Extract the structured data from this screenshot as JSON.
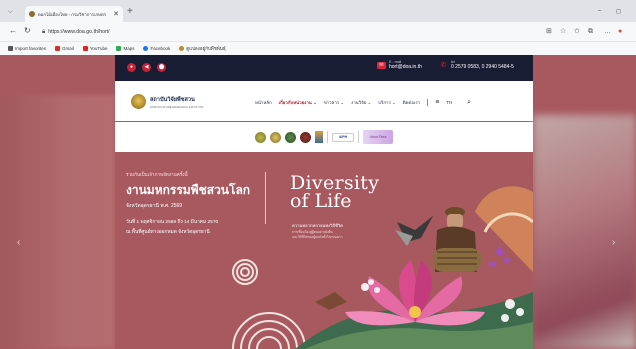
{
  "browser": {
    "tab_title": "ดอกไม้เมืองไทย - กรมวิชาการเกษตร",
    "url": "https://www.doa.go.th/hort/",
    "favorites": [
      {
        "label": "Import favorites",
        "color": "#555555"
      },
      {
        "label": "Gmail",
        "color": "#555555"
      },
      {
        "label": "YouTube",
        "color": "#e02424"
      },
      {
        "label": "Maps",
        "color": "#555555"
      },
      {
        "label": "Facebook",
        "color": "#1877f2"
      },
      {
        "label": "ดูแปลงอยู่กับพืชพันธุ์",
        "color": "#b58f2e"
      }
    ]
  },
  "site": {
    "contact": {
      "email_label": "E - mail",
      "email": "hort@doa.in.th",
      "tel_label": "tel",
      "tel": "0 2579 0583, 0 2940 5484-5"
    },
    "logo": {
      "name": "สถาบันวิจัยพืชสวน",
      "subtitle": "HORTICULTURE RESEARCH INSTITUTE"
    },
    "menu": [
      {
        "label": "หน้าหลัก",
        "active": false
      },
      {
        "label": "เกี่ยวกับหน่วยงาน ⌄",
        "active": true
      },
      {
        "label": "ข่าวสาร ⌄",
        "active": false
      },
      {
        "label": "งานวิจัย ⌄",
        "active": false
      },
      {
        "label": "บริการ ⌄",
        "active": false
      },
      {
        "label": "ติดต่อเรา",
        "active": false
      }
    ],
    "lang": "TH",
    "partners": {
      "aiph": "AIPH",
      "flora": "Udon Flora"
    },
    "hero": {
      "intro": "ร่วมกันเป็นเจ้าภาพจัดงานครั้งนี้",
      "title": "งานมหกรรมพืชสวนโลก",
      "subtitle": "จังหวัดอุดรธานี พ.ศ. 2569",
      "date": "วันที่ 1 พฤศจิกายน 2569 ถึง 14 มีนาคม 2570",
      "venue": "ณ พื้นที่ศูนย์ทางออกหมด จังหวัดอุดรธานี",
      "dol_line1": "Diversity",
      "dol_line2": "of Life",
      "th_title": "ความหลากหลายแห่งวิถีชีวิต",
      "th_sub1": "การเชื่อมโยงสู่ผู้คนอย่างยั่งยืน",
      "th_sub2": "และวิถีชีวิตของผู้คนทั่วทั้งโลกของเรา"
    }
  },
  "colors": {
    "topbar": "#191d33",
    "accent": "#c72338",
    "hero_bg": "#a8595f"
  }
}
